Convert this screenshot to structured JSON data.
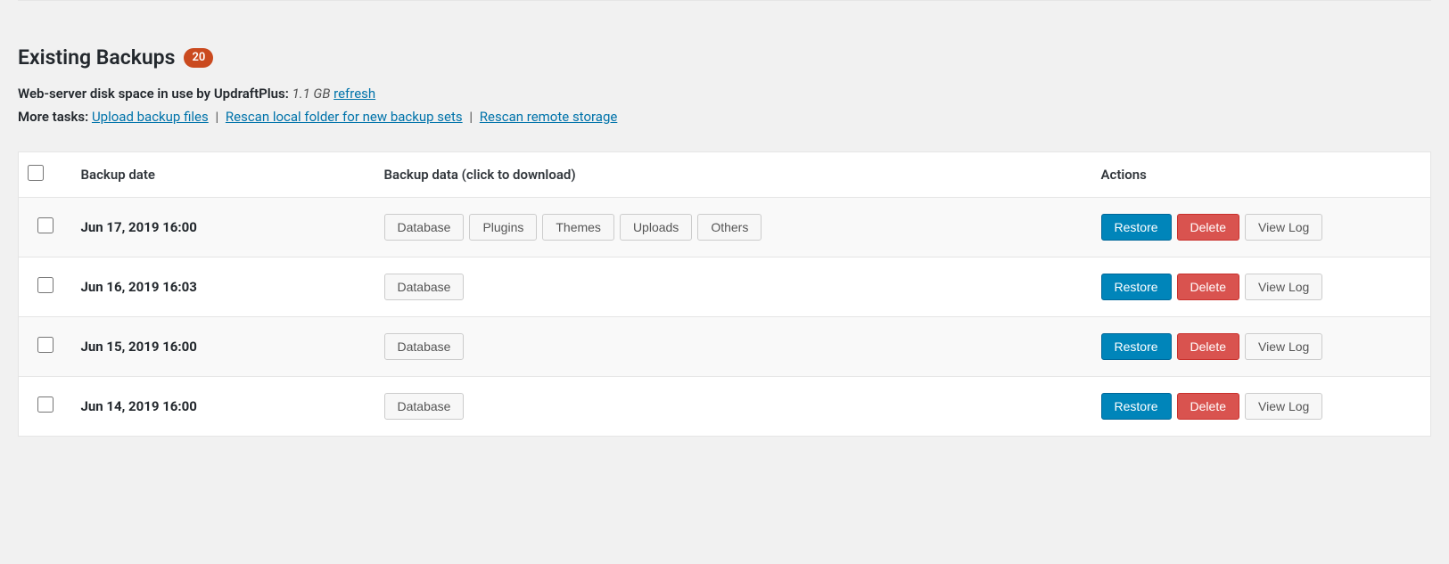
{
  "header": {
    "title": "Existing Backups",
    "count": "20"
  },
  "diskSpace": {
    "label": "Web-server disk space in use by UpdraftPlus:",
    "value": "1.1 GB",
    "refreshLink": "refresh"
  },
  "moreTasks": {
    "label": "More tasks:",
    "uploadLink": "Upload backup files",
    "rescanLocalLink": "Rescan local folder for new backup sets",
    "rescanRemoteLink": "Rescan remote storage"
  },
  "table": {
    "columns": {
      "date": "Backup date",
      "data": "Backup data (click to download)",
      "actions": "Actions"
    },
    "dataButtons": {
      "database": "Database",
      "plugins": "Plugins",
      "themes": "Themes",
      "uploads": "Uploads",
      "others": "Others"
    },
    "actionButtons": {
      "restore": "Restore",
      "delete": "Delete",
      "viewLog": "View Log"
    },
    "rows": [
      {
        "date": "Jun 17, 2019 16:00",
        "data": [
          "database",
          "plugins",
          "themes",
          "uploads",
          "others"
        ]
      },
      {
        "date": "Jun 16, 2019 16:03",
        "data": [
          "database"
        ]
      },
      {
        "date": "Jun 15, 2019 16:00",
        "data": [
          "database"
        ]
      },
      {
        "date": "Jun 14, 2019 16:00",
        "data": [
          "database"
        ]
      }
    ]
  }
}
